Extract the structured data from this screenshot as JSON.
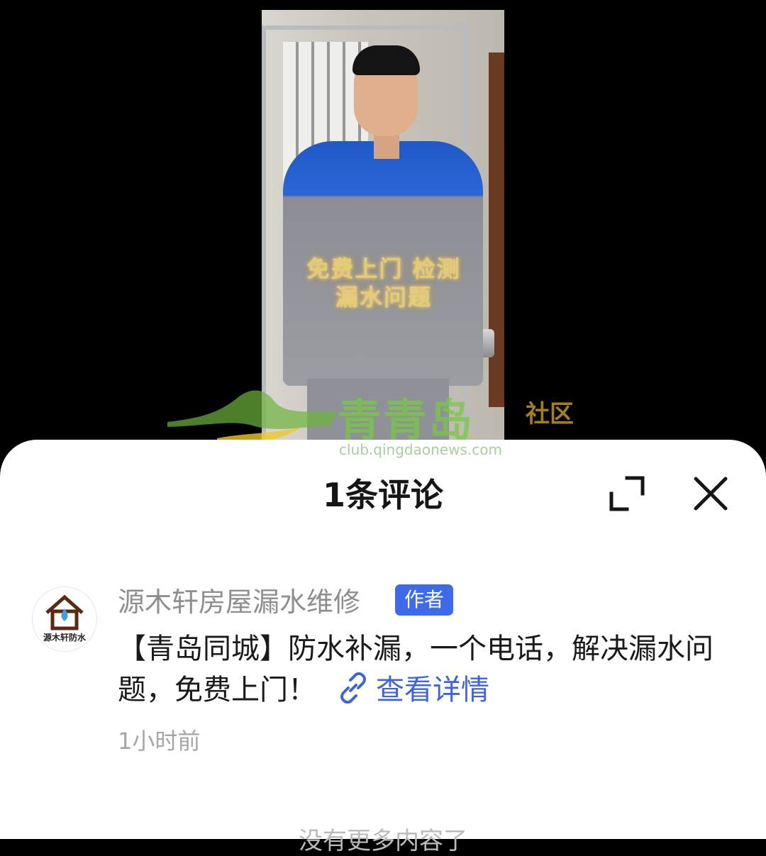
{
  "video": {
    "overlay_caption": "免费上门 检测漏水问题",
    "watermark_title": "青青岛",
    "watermark_sub": "社区",
    "watermark_url": "club.qingdaonews.com"
  },
  "sheet": {
    "title": "1条评论"
  },
  "comment": {
    "avatar_text": "源木轩防水",
    "author": "源木轩房屋漏水维修",
    "badge": "作者",
    "text": "【青岛同城】防水补漏，一个电话，解决漏水问题，免费上门！",
    "link_label": "查看详情",
    "time": "1小时前"
  },
  "footer": {
    "no_more": "没有更多内容了"
  },
  "colors": {
    "badge": "#3f6bea",
    "link": "#3d64d8"
  }
}
